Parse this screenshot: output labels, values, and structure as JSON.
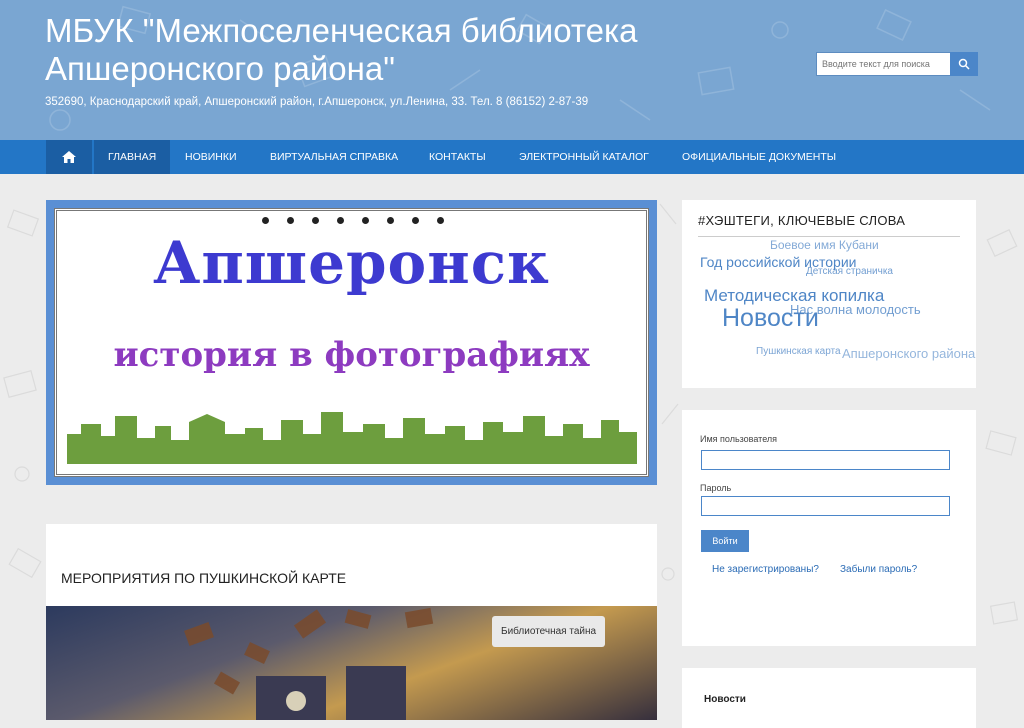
{
  "header": {
    "title": "МБУК \"Межпоселенческая библиотека Апшеронского района\"",
    "subtitle": "352690, Краснодарский край, Апшеронский район, г.Апшеронск, ул.Ленина, 33. Тел. 8 (86152) 2-87-39"
  },
  "search": {
    "placeholder": "Вводите текст для поиска",
    "icon": "search-icon"
  },
  "nav": {
    "home_icon": "home-icon",
    "items": [
      {
        "label": "Главная",
        "active": true
      },
      {
        "label": "Новинки"
      },
      {
        "label": "Виртуальная справка"
      },
      {
        "label": "Контакты"
      },
      {
        "label": "Электронный каталог"
      },
      {
        "label": "Официальные документы"
      }
    ]
  },
  "slider": {
    "title_line1": "Апшеронск",
    "title_line2": "история в фотографиях",
    "dot_count": 8
  },
  "post": {
    "title": "МЕРОПРИЯТИЯ ПО ПУШКИНСКОЙ КАРТЕ",
    "badge": "Библиотечная тайна"
  },
  "tags": {
    "title": "#ХЭШТЕГИ, КЛЮЧЕВЫЕ СЛОВА",
    "words": [
      {
        "text": "Боевое имя Кубани"
      },
      {
        "text": "Год российской истории"
      },
      {
        "text": "Детская страничка"
      },
      {
        "text": "Методическая копилка"
      },
      {
        "text": "Нас волна молодость"
      },
      {
        "text": "Новости"
      },
      {
        "text": "Пушкинская карта"
      },
      {
        "text": "Апшеронского района"
      }
    ]
  },
  "login": {
    "username_label": "Имя пользователя",
    "password_label": "Пароль",
    "submit_label": "Войти",
    "register_link": "Не зарегистрированы?",
    "forgot_link": "Забыли пароль?"
  },
  "news_widget": {
    "title": "Новости"
  },
  "colors": {
    "header_bg": "#7aa6d2",
    "nav_bg": "#2376c6",
    "nav_active": "#1b5ea3",
    "link": "#2a6bb5",
    "tag_color": "#4f86c6"
  }
}
